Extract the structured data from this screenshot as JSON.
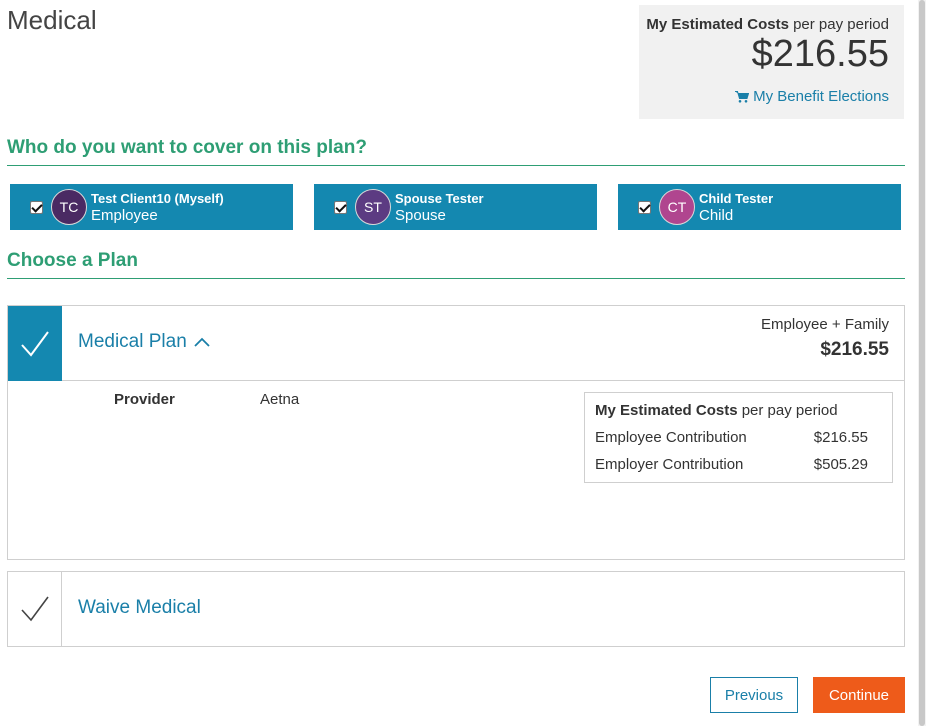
{
  "page": {
    "title": "Medical"
  },
  "summary": {
    "heading_bold": "My Estimated Costs",
    "heading_rest": " per pay period",
    "amount": "$216.55",
    "elections_link": "My Benefit Elections"
  },
  "coverage": {
    "title": "Who do you want to cover on this plan?",
    "members": [
      {
        "initials": "TC",
        "name": "Test Client10 (Myself)",
        "role": "Employee",
        "checked": true,
        "avatar_color": "#4a2a63"
      },
      {
        "initials": "ST",
        "name": "Spouse Tester",
        "role": "Spouse",
        "checked": true,
        "avatar_color": "#5c3b82"
      },
      {
        "initials": "CT",
        "name": "Child Tester",
        "role": "Child",
        "checked": true,
        "avatar_color": "#b0458f"
      }
    ]
  },
  "plans": {
    "title": "Choose a Plan",
    "medical": {
      "name": "Medical Plan",
      "coverage_level": "Employee + Family",
      "price": "$216.55",
      "provider_label": "Provider",
      "provider_value": "Aetna",
      "est_heading_bold": "My Estimated Costs",
      "est_heading_rest": " per pay period",
      "rows": [
        {
          "label": "Employee Contribution",
          "value": "$216.55"
        },
        {
          "label": "Employer Contribution",
          "value": "$505.29"
        }
      ]
    },
    "waive": {
      "name": "Waive Medical"
    }
  },
  "actions": {
    "previous": "Previous",
    "continue": "Continue"
  },
  "colors": {
    "accent": "#1488b0",
    "section": "#2e9e74",
    "continue": "#ee5b1a"
  }
}
